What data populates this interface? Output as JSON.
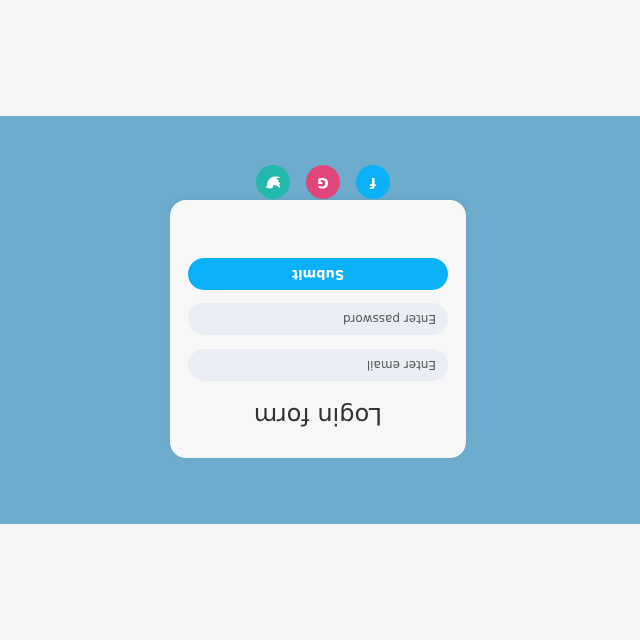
{
  "form": {
    "title": "Login form",
    "email_placeholder": "Enter email",
    "password_placeholder": "Enter password",
    "submit_label": "Submit"
  },
  "social": [
    {
      "name": "facebook",
      "glyph": "f",
      "color": "#0ab1f7"
    },
    {
      "name": "google",
      "glyph": "G",
      "color": "#e0467a"
    },
    {
      "name": "twitter",
      "glyph": "bird",
      "color": "#23b8ac"
    }
  ],
  "colors": {
    "background": "#f6f6f6",
    "band": "#6eacce",
    "card": "#f7f7f7",
    "input": "#eaeef4",
    "submit": "#0ab1f7"
  }
}
